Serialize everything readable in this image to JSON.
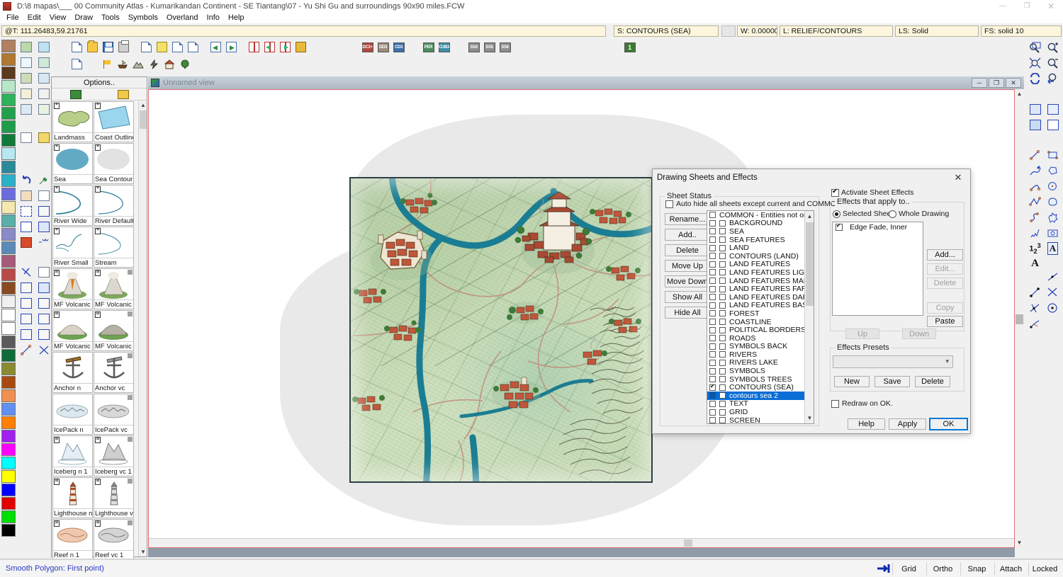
{
  "window": {
    "title": "D:\\8 mapas\\___ 00 Community Atlas - Kumarikandan Continent - SE Tiantang\\07 - Yu Shi Gu and surroundings 90x90 miles.FCW",
    "minimize": "—",
    "maximize": "❐",
    "close": "✕"
  },
  "menu": {
    "items": [
      "File",
      "Edit",
      "View",
      "Draw",
      "Tools",
      "Symbols",
      "Overland",
      "Info",
      "Help"
    ]
  },
  "status_strip": {
    "coords": "@T: 111.26483,59.21761",
    "sheet": "S: CONTOURS (SEA)",
    "color_swatch": "",
    "width": "W: 0.00000",
    "layer": "L: RELIEF/CONTOURS",
    "linestyle": "LS: Solid",
    "fillstyle": "FS: solid 10"
  },
  "toolbar": {
    "row1": [
      {
        "name": "new-drawing",
        "icon": "doc"
      },
      {
        "name": "open-drawing",
        "icon": "folder"
      },
      {
        "name": "save-drawing",
        "icon": "save"
      },
      {
        "name": "print-drawing",
        "icon": "print"
      },
      {
        "name": "drawing-properties",
        "icon": "doc-gear"
      },
      {
        "name": "notes",
        "icon": "note"
      },
      {
        "name": "edit-text",
        "icon": "doc-edit"
      },
      {
        "name": "map-notes",
        "icon": "doc-map"
      },
      {
        "name": "previous-view",
        "icon": "doc-left"
      },
      {
        "name": "next-view",
        "icon": "doc-right"
      },
      {
        "name": "open-book",
        "icon": "book"
      },
      {
        "name": "book-previous",
        "icon": "book-left"
      },
      {
        "name": "book-next",
        "icon": "book-right"
      },
      {
        "name": "browse-folder",
        "icon": "binoculars"
      }
    ],
    "row2": [
      {
        "name": "insert-image",
        "icon": "image"
      },
      {
        "name": "flag-tool",
        "icon": "flag"
      },
      {
        "name": "ship-tool",
        "icon": "ship"
      },
      {
        "name": "mountain-tool",
        "icon": "mountain"
      },
      {
        "name": "storm-tool",
        "icon": "storm"
      },
      {
        "name": "building-tool",
        "icon": "building"
      },
      {
        "name": "tree-tool",
        "icon": "tree"
      }
    ],
    "cubes": [
      {
        "name": "dc3-plus",
        "label": "DC3+",
        "color": "#b0483c"
      },
      {
        "name": "dd3",
        "label": "DD3",
        "color": "#9d8b7a"
      },
      {
        "name": "cd3",
        "label": "CD3",
        "color": "#3c6fa8"
      },
      {
        "name": "per",
        "label": "PER",
        "color": "#4a8d5e"
      },
      {
        "name": "cub3",
        "label": "CUB3",
        "color": "#3c8ea8"
      },
      {
        "name": "ss4",
        "label": "SS4",
        "color": "#8d8d8d"
      },
      {
        "name": "ss5",
        "label": "SS5",
        "color": "#8d8d8d"
      },
      {
        "name": "ss6",
        "label": "SS6",
        "color": "#8d8d8d"
      },
      {
        "name": "sheet-one",
        "label": "1",
        "color": "#3e7a32"
      }
    ]
  },
  "palette": {
    "colors": [
      "#b08060",
      "#b07830",
      "#5c3a1e",
      "#b8e6c8",
      "#2fb25a",
      "#22a04c",
      "#1f9d4a",
      "#0f7a3a",
      "#b8e8f2",
      "#2a8a9a",
      "#2ab0c8",
      "#6b6be0",
      "#f4e7b0",
      "#5ab0a8",
      "#8a8ac8",
      "#5a8ab8",
      "#a85a7a",
      "#b84a4a",
      "#8a4a20",
      "#f0f0f0",
      "#ffffff",
      "#ffffff",
      "#5a5a5a",
      "#0e6b3a",
      "#8a8a30",
      "#a84a10",
      "#f09050",
      "#6090f0",
      "#ff8000",
      "#a020f0",
      "#ff00ff",
      "#00ffff",
      "#ffff00",
      "#0000ff",
      "#e00000",
      "#00e000",
      "#000000"
    ]
  },
  "catalog": {
    "options_label": "Options..",
    "items": [
      {
        "label": "Landmass",
        "kind": "landmass",
        "badge": "⌗"
      },
      {
        "label": "Coast Outline",
        "kind": "coast",
        "badge": "⌗"
      },
      {
        "label": "Sea",
        "kind": "sea",
        "badge": "⌗"
      },
      {
        "label": "Sea Contour",
        "kind": "seacontour",
        "badge": "⌗"
      },
      {
        "label": "River Wide",
        "kind": "riverwide",
        "badge": "⌗"
      },
      {
        "label": "River Default",
        "kind": "riverdef",
        "badge": "⌗"
      },
      {
        "label": "River Small",
        "kind": "riversmall",
        "badge": "⌗"
      },
      {
        "label": "Stream",
        "kind": "stream",
        "badge": "⌗"
      },
      {
        "label": "MF Volcanic Isl",
        "kind": "volcano-n",
        "badge": "⊞"
      },
      {
        "label": "MF Volcanic Isl",
        "kind": "volcano-vc",
        "badge": "⊞"
      },
      {
        "label": "MF Volcanic Isl",
        "kind": "volcano2-n",
        "badge": "⊞"
      },
      {
        "label": "MF Volcanic Isl",
        "kind": "volcano2-vc",
        "badge": "⊞"
      },
      {
        "label": "Anchor n",
        "kind": "anchor-n",
        "badge": ""
      },
      {
        "label": "Anchor vc",
        "kind": "anchor-vc",
        "badge": ""
      },
      {
        "label": "IcePack n",
        "kind": "icepack-n",
        "badge": ""
      },
      {
        "label": "IcePack vc",
        "kind": "icepack-vc",
        "badge": ""
      },
      {
        "label": "Iceberg n 1",
        "kind": "iceberg-n",
        "badge": "⊞"
      },
      {
        "label": "Iceberg vc 1",
        "kind": "iceberg-vc",
        "badge": "⊞"
      },
      {
        "label": "Lighthouse n",
        "kind": "lighthouse-n",
        "badge": "⊞"
      },
      {
        "label": "Lighthouse vc",
        "kind": "lighthouse-vc",
        "badge": "⊞"
      },
      {
        "label": "Reef n 1",
        "kind": "reef-n",
        "badge": "⊞"
      },
      {
        "label": "Reef vc 1",
        "kind": "reef-vc",
        "badge": "⊞"
      }
    ]
  },
  "view": {
    "tab_title": "Unnamed view",
    "minimize": "─",
    "restore": "❐",
    "close": "✕"
  },
  "dialog": {
    "title": "Drawing Sheets and Effects",
    "close": "✕",
    "sheet_status": {
      "legend": "Sheet Status",
      "auto_hide_label": "Auto hide all sheets except current and COMMON",
      "auto_hide_checked": false,
      "buttons": [
        {
          "name": "rename-button",
          "label": "Rename...",
          "enabled": true
        },
        {
          "name": "add-sheet-button",
          "label": "Add..",
          "enabled": true
        },
        {
          "name": "delete-sheet-button",
          "label": "Delete",
          "enabled": true
        },
        {
          "name": "move-up-button",
          "label": "Move Up",
          "enabled": true
        },
        {
          "name": "move-down-button",
          "label": "Move Down",
          "enabled": true
        },
        {
          "name": "show-all-button",
          "label": "Show All",
          "enabled": true
        },
        {
          "name": "hide-all-button",
          "label": "Hide All",
          "enabled": true
        }
      ],
      "sheets": [
        {
          "label": "COMMON - Entities not on any",
          "c1": false,
          "c2": null,
          "selected": false
        },
        {
          "label": "BACKGROUND",
          "c1": false,
          "c2": false,
          "selected": false
        },
        {
          "label": "SEA",
          "c1": false,
          "c2": false,
          "selected": false
        },
        {
          "label": "SEA FEATURES",
          "c1": false,
          "c2": false,
          "selected": false
        },
        {
          "label": "LAND",
          "c1": false,
          "c2": false,
          "selected": false
        },
        {
          "label": "CONTOURS (LAND)",
          "c1": false,
          "c2": false,
          "selected": false
        },
        {
          "label": "LAND FEATURES",
          "c1": false,
          "c2": false,
          "selected": false
        },
        {
          "label": "LAND FEATURES  LIGHT GREEN",
          "c1": false,
          "c2": false,
          "selected": false
        },
        {
          "label": "LAND FEATURES MARSH",
          "c1": false,
          "c2": false,
          "selected": false
        },
        {
          "label": "LAND FEATURES FARM",
          "c1": false,
          "c2": false,
          "selected": false
        },
        {
          "label": "LAND FEATURES DAR GREEN F",
          "c1": false,
          "c2": false,
          "selected": false
        },
        {
          "label": "LAND FEATURES BASE CITY",
          "c1": false,
          "c2": false,
          "selected": false
        },
        {
          "label": "FOREST",
          "c1": false,
          "c2": false,
          "selected": false
        },
        {
          "label": "COASTLINE",
          "c1": false,
          "c2": false,
          "selected": false
        },
        {
          "label": "POLITICAL BORDERS",
          "c1": false,
          "c2": false,
          "selected": false
        },
        {
          "label": "ROADS",
          "c1": false,
          "c2": false,
          "selected": false
        },
        {
          "label": "SYMBOLS BACK",
          "c1": false,
          "c2": false,
          "selected": false
        },
        {
          "label": "RIVERS",
          "c1": false,
          "c2": false,
          "selected": false
        },
        {
          "label": "RIVERS LAKE",
          "c1": false,
          "c2": false,
          "selected": false
        },
        {
          "label": "SYMBOLS",
          "c1": false,
          "c2": false,
          "selected": false
        },
        {
          "label": "SYMBOLS TREES",
          "c1": false,
          "c2": false,
          "selected": false
        },
        {
          "label": "CONTOURS (SEA)",
          "c1": true,
          "c2": false,
          "selected": false
        },
        {
          "label": "contours sea 2",
          "c1": false,
          "c2": false,
          "selected": true
        },
        {
          "label": "TEXT",
          "c1": false,
          "c2": false,
          "selected": false
        },
        {
          "label": "GRID",
          "c1": false,
          "c2": false,
          "selected": false
        },
        {
          "label": "SCREEN",
          "c1": false,
          "c2": false,
          "selected": false
        }
      ]
    },
    "effects": {
      "activate_label": "Activate Sheet Effects",
      "activate_checked": true,
      "applies_legend": "Effects that apply to..",
      "radio_selected_sheet": "Selected Sheet",
      "radio_whole_drawing": "Whole Drawing",
      "radio_value": "selected_sheet",
      "list": [
        {
          "label": "Edge Fade, Inner",
          "checked": true
        }
      ],
      "buttons": [
        {
          "name": "effect-add-button",
          "label": "Add...",
          "enabled": true
        },
        {
          "name": "effect-edit-button",
          "label": "Edit...",
          "enabled": false
        },
        {
          "name": "effect-delete-button",
          "label": "Delete",
          "enabled": false
        },
        {
          "name": "effect-copy-button",
          "label": "Copy",
          "enabled": false
        },
        {
          "name": "effect-paste-button",
          "label": "Paste",
          "enabled": true
        }
      ],
      "up_label": "Up",
      "down_label": "Down",
      "up_enabled": false,
      "down_enabled": false
    },
    "presets": {
      "legend": "Effects Presets",
      "value": "",
      "placeholder": "",
      "buttons": [
        {
          "name": "preset-new-button",
          "label": "New"
        },
        {
          "name": "preset-save-button",
          "label": "Save"
        },
        {
          "name": "preset-delete-button",
          "label": "Delete"
        }
      ]
    },
    "redraw_label": "Redraw on OK.",
    "redraw_checked": false,
    "footer": [
      {
        "name": "help-button",
        "label": "Help",
        "default": false
      },
      {
        "name": "apply-button",
        "label": "Apply",
        "default": false
      },
      {
        "name": "ok-button",
        "label": "OK",
        "default": true
      }
    ]
  },
  "statusbar": {
    "message": "Smooth Polygon: First point)",
    "toggles": [
      "Grid",
      "Ortho",
      "Snap",
      "Attach",
      "Locked"
    ]
  },
  "colors": {
    "accent": "#0b6ed6",
    "dialog_bg": "#f0f0f0",
    "field_bg": "#fdf6dd",
    "status_text": "#2b3ac0",
    "river": "#1b7d93",
    "map_border": "#2d3f45"
  }
}
